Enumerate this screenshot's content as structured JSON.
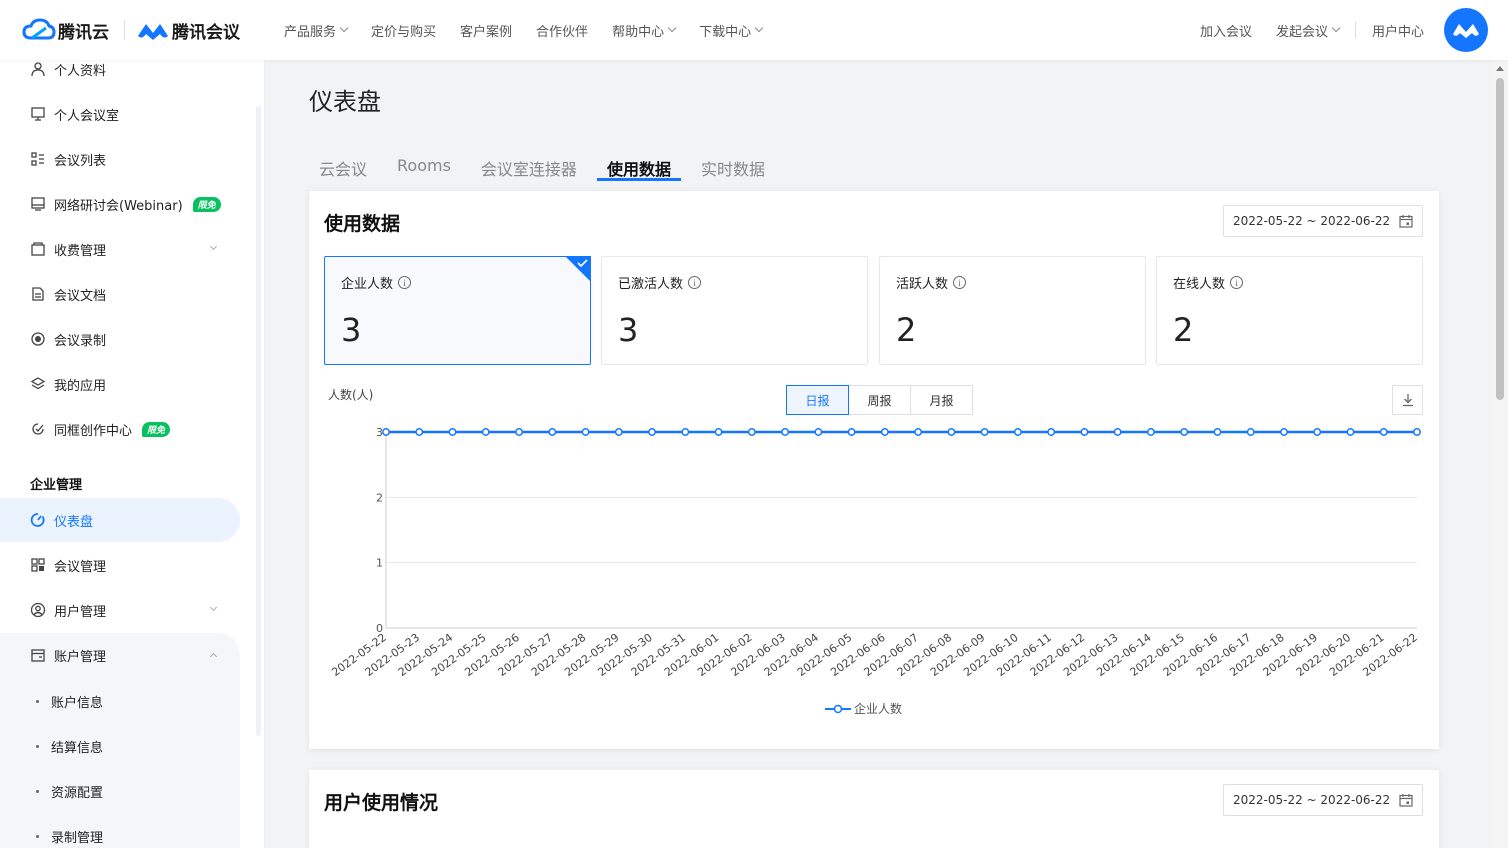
{
  "header": {
    "brand_cloud": "腾讯云",
    "brand_meeting": "腾讯会议",
    "nav": [
      "产品服务",
      "定价与购买",
      "客户案例",
      "合作伙伴",
      "帮助中心",
      "下载中心"
    ],
    "nav_dropdown": [
      true,
      false,
      false,
      false,
      true,
      true
    ],
    "right": {
      "join": "加入会议",
      "start": "发起会议",
      "user_center": "用户中心"
    }
  },
  "sidebar": {
    "items": [
      {
        "label": "个人资料",
        "icon": "user-icon"
      },
      {
        "label": "个人会议室",
        "icon": "meeting-room-icon"
      },
      {
        "label": "会议列表",
        "icon": "list-icon"
      },
      {
        "label": "网络研讨会(Webinar)",
        "icon": "monitor-icon",
        "badge": "限免"
      },
      {
        "label": "收费管理",
        "icon": "wallet-icon"
      },
      {
        "label": "会议文档",
        "icon": "document-icon"
      },
      {
        "label": "会议录制",
        "icon": "record-icon"
      },
      {
        "label": "我的应用",
        "icon": "layers-icon"
      },
      {
        "label": "同框创作中心",
        "icon": "creation-icon",
        "badge": "限免"
      }
    ],
    "group_title": "企业管理",
    "enterprise": [
      {
        "label": "仪表盘",
        "icon": "dashboard-icon",
        "active": true
      },
      {
        "label": "会议管理",
        "icon": "grid-icon"
      },
      {
        "label": "用户管理",
        "icon": "users-icon"
      },
      {
        "label": "账户管理",
        "icon": "account-icon"
      }
    ],
    "account_sub": [
      "账户信息",
      "结算信息",
      "资源配置",
      "录制管理"
    ]
  },
  "page": {
    "title": "仪表盘",
    "tabs": [
      "云会议",
      "Rooms",
      "会议室连接器",
      "使用数据",
      "实时数据"
    ],
    "active_tab": 3
  },
  "usage": {
    "title": "使用数据",
    "date_range": "2022-05-22 ~ 2022-06-22",
    "stats": [
      {
        "label": "企业人数",
        "value": "3",
        "selected": true
      },
      {
        "label": "已激活人数",
        "value": "3"
      },
      {
        "label": "活跃人数",
        "value": "2"
      },
      {
        "label": "在线人数",
        "value": "2"
      }
    ],
    "segments": [
      "日报",
      "周报",
      "月报"
    ],
    "active_segment": 0
  },
  "user_usage": {
    "title": "用户使用情况",
    "date_range": "2022-05-22 ~ 2022-06-22"
  },
  "colors": {
    "accent": "#1476ff",
    "badge": "#07c160"
  },
  "chart_data": {
    "type": "line",
    "ylabel": "人数(人)",
    "ylim": [
      0,
      3
    ],
    "yticks": [
      0,
      1,
      2,
      3
    ],
    "grid": true,
    "legend": "bottom-center",
    "x": [
      "2022-05-22",
      "2022-05-23",
      "2022-05-24",
      "2022-05-25",
      "2022-05-26",
      "2022-05-27",
      "2022-05-28",
      "2022-05-29",
      "2022-05-30",
      "2022-05-31",
      "2022-06-01",
      "2022-06-02",
      "2022-06-03",
      "2022-06-04",
      "2022-06-05",
      "2022-06-06",
      "2022-06-07",
      "2022-06-08",
      "2022-06-09",
      "2022-06-10",
      "2022-06-11",
      "2022-06-12",
      "2022-06-13",
      "2022-06-14",
      "2022-06-15",
      "2022-06-16",
      "2022-06-17",
      "2022-06-18",
      "2022-06-19",
      "2022-06-20",
      "2022-06-21",
      "2022-06-22"
    ],
    "series": [
      {
        "name": "企业人数",
        "color": "#1476ff",
        "values": [
          3,
          3,
          3,
          3,
          3,
          3,
          3,
          3,
          3,
          3,
          3,
          3,
          3,
          3,
          3,
          3,
          3,
          3,
          3,
          3,
          3,
          3,
          3,
          3,
          3,
          3,
          3,
          3,
          3,
          3,
          3,
          3
        ]
      }
    ]
  }
}
